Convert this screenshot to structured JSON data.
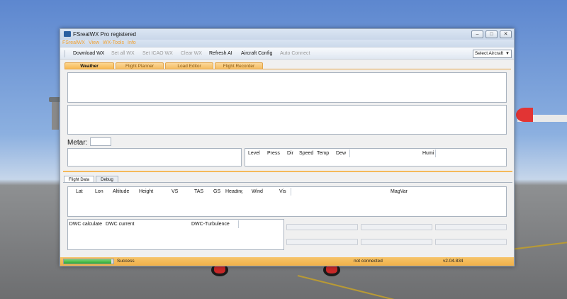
{
  "window": {
    "title": "FSrealWX Pro registered",
    "min": "–",
    "max": "□",
    "close": "✕"
  },
  "menu": [
    "FSrealWX",
    "View",
    "WX-Tools",
    "Info"
  ],
  "toolbar": {
    "download_wx": "Download WX",
    "set_all_wx": "Set all WX",
    "set_icao_wx": "Set ICAO WX",
    "clear_wx": "Clear WX",
    "refresh_ai": "Refresh AI",
    "aircraft_config": "Aircraft Config",
    "auto_connect": "Auto Connect",
    "select_aircraft": "Select Aircraft"
  },
  "tabs": [
    "Weather",
    "Flight Planner",
    "Load Editor",
    "Flight Recorder"
  ],
  "weather": {
    "metar_label": "Metar:",
    "level_columns": [
      "Level",
      "Press",
      "Dir",
      "Speed",
      "Temp",
      "Dew",
      "Humi"
    ]
  },
  "bottom_tabs": [
    "Flight Data",
    "Debug"
  ],
  "flight_data_columns": [
    "Lat",
    "Lon",
    "Altitude",
    "Height",
    "VS",
    "TAS",
    "GS",
    "Heading",
    "Wind",
    "Vis",
    "MagVar"
  ],
  "dwc_columns": [
    "DWC calculate",
    "DWC current",
    "DWC-Turbulence"
  ],
  "status": {
    "progress_fraction": 0.95,
    "message": "Success",
    "connection": "not connected",
    "version": "v2.04.834"
  },
  "colors": {
    "accent_orange": "#f4b95a",
    "menu_text": "#f0a030",
    "progress_green": "#2fa92f"
  }
}
